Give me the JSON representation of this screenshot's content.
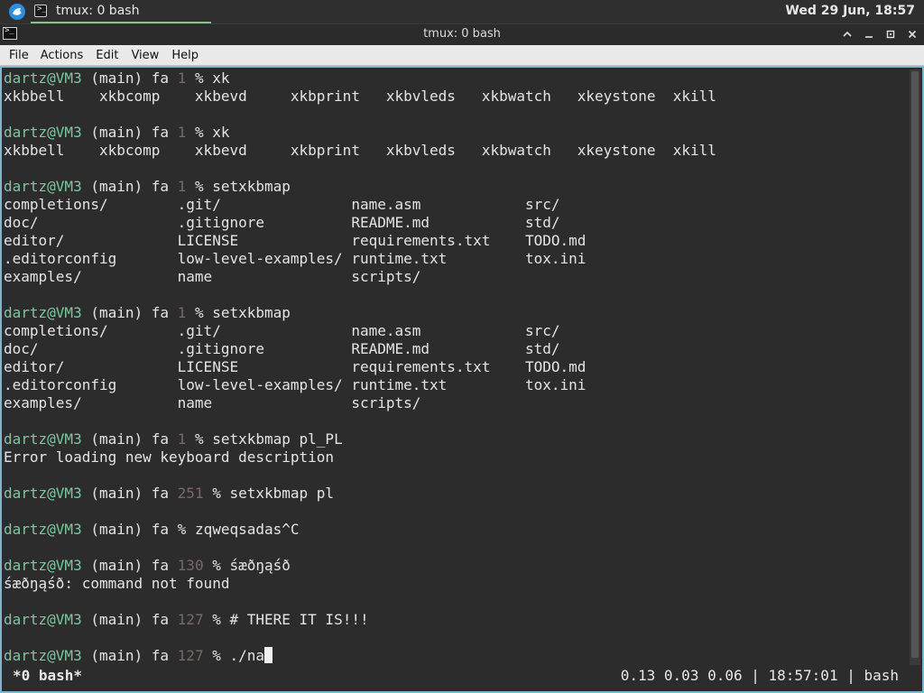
{
  "panel": {
    "task_label": "tmux: 0 bash",
    "clock": "Wed 29 Jun, 18:57"
  },
  "window": {
    "title": "tmux: 0 bash"
  },
  "menu": {
    "file": "File",
    "actions": "Actions",
    "edit": "Edit",
    "view": "View",
    "help": "Help"
  },
  "terminal": {
    "prompt_user": "dartz@VM3",
    "prompt_rest": " (main) fa ",
    "lines": [
      {
        "type": "prompt",
        "code": "1 ",
        "cmd": "% xk"
      },
      {
        "type": "out",
        "text": "xkbbell    xkbcomp    xkbevd     xkbprint   xkbvleds   xkbwatch   xkeystone  xkill"
      },
      {
        "type": "blank",
        "text": ""
      },
      {
        "type": "prompt",
        "code": "1 ",
        "cmd": "% xk"
      },
      {
        "type": "out",
        "text": "xkbbell    xkbcomp    xkbevd     xkbprint   xkbvleds   xkbwatch   xkeystone  xkill"
      },
      {
        "type": "blank",
        "text": ""
      },
      {
        "type": "prompt",
        "code": "1 ",
        "cmd": "% setxkbmap"
      },
      {
        "type": "out",
        "text": "completions/        .git/               name.asm            src/"
      },
      {
        "type": "out",
        "text": "doc/                .gitignore          README.md           std/"
      },
      {
        "type": "out",
        "text": "editor/             LICENSE             requirements.txt    TODO.md"
      },
      {
        "type": "out",
        "text": ".editorconfig       low-level-examples/ runtime.txt         tox.ini"
      },
      {
        "type": "out",
        "text": "examples/           name                scripts/"
      },
      {
        "type": "blank",
        "text": ""
      },
      {
        "type": "prompt",
        "code": "1 ",
        "cmd": "% setxkbmap"
      },
      {
        "type": "out",
        "text": "completions/        .git/               name.asm            src/"
      },
      {
        "type": "out",
        "text": "doc/                .gitignore          README.md           std/"
      },
      {
        "type": "out",
        "text": "editor/             LICENSE             requirements.txt    TODO.md"
      },
      {
        "type": "out",
        "text": ".editorconfig       low-level-examples/ runtime.txt         tox.ini"
      },
      {
        "type": "out",
        "text": "examples/           name                scripts/"
      },
      {
        "type": "blank",
        "text": ""
      },
      {
        "type": "prompt",
        "code": "1 ",
        "cmd": "% setxkbmap pl_PL"
      },
      {
        "type": "out",
        "text": "Error loading new keyboard description"
      },
      {
        "type": "blank",
        "text": ""
      },
      {
        "type": "prompt",
        "code": "251 ",
        "cmd": "% setxkbmap pl"
      },
      {
        "type": "blank",
        "text": ""
      },
      {
        "type": "prompt",
        "code": "",
        "cmd": "% zqweqsadas^C"
      },
      {
        "type": "blank",
        "text": ""
      },
      {
        "type": "prompt",
        "code": "130 ",
        "cmd": "% śæðŋąśð"
      },
      {
        "type": "out",
        "text": "śæðŋąśð: command not found"
      },
      {
        "type": "blank",
        "text": ""
      },
      {
        "type": "prompt",
        "code": "127 ",
        "cmd": "% # THERE IT IS!!!"
      },
      {
        "type": "blank",
        "text": ""
      },
      {
        "type": "prompt",
        "code": "127 ",
        "cmd": "% ./na",
        "cursor": true
      }
    ]
  },
  "status": {
    "left": "*0 bash*",
    "right": "0.13 0.03 0.06 | 18:57:01 | bash"
  }
}
